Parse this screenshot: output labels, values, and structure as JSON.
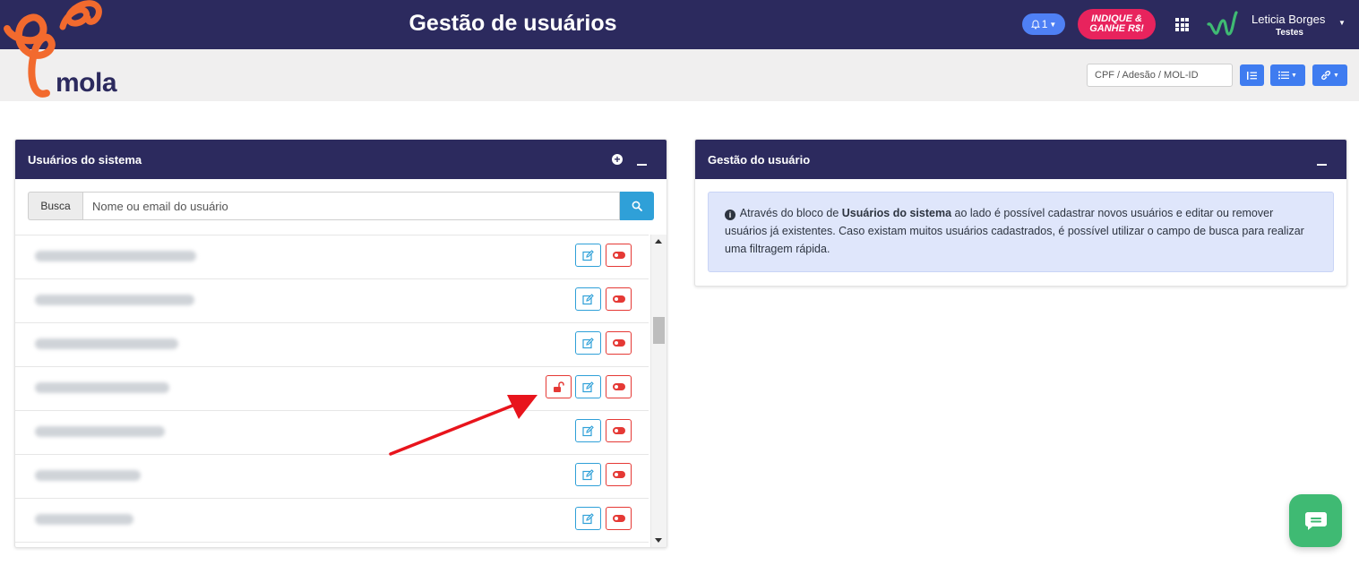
{
  "header": {
    "title": "Gestão de usuários",
    "notifications": {
      "count": "1",
      "icon": "bell-icon"
    },
    "promo": {
      "line1": "INDIQUE &",
      "line2": "GANHE R$!"
    },
    "user": {
      "name": "Leticia Borges",
      "environment": "Testes"
    }
  },
  "brand": {
    "logo_text": "mola"
  },
  "toolbar": {
    "lookup_placeholder": "CPF / Adesão / MOL-ID"
  },
  "users_panel": {
    "title": "Usuários do sistema",
    "search": {
      "label": "Busca",
      "placeholder": "Nome ou email do usuário"
    },
    "rows": [
      {
        "locked": false
      },
      {
        "locked": false
      },
      {
        "locked": false
      },
      {
        "locked": true
      },
      {
        "locked": false
      },
      {
        "locked": false
      },
      {
        "locked": false
      }
    ]
  },
  "manage_panel": {
    "title": "Gestão do usuário",
    "info": {
      "prefix": "Através do bloco de ",
      "emphasis": "Usuários do sistema",
      "suffix": " ao lado é possível cadastrar novos usuários e editar ou remover usuários já existentes. Caso existam muitos usuários cadastrados, é possível utilizar o campo de busca para realizar uma filtragem rápida."
    }
  },
  "colors": {
    "navy": "#2c2a5e",
    "primary_blue": "#3f7cf0",
    "info_blue": "#2fa0d8",
    "danger": "#e53935",
    "promo_pink": "#e8235d",
    "chat_green": "#3fba73",
    "brand_orange": "#f26a2e"
  }
}
